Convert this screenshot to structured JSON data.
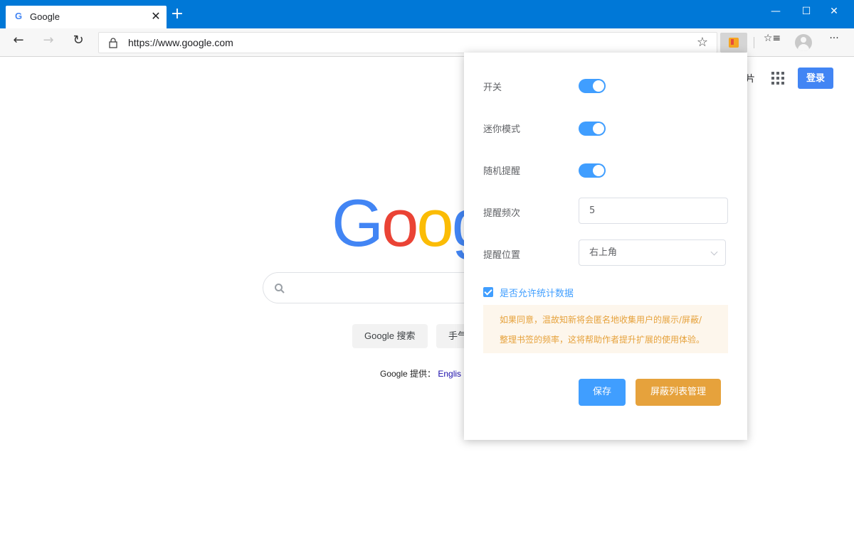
{
  "browser": {
    "tab": {
      "favicon": "G",
      "title": "Google",
      "close": "✕"
    },
    "new_tab": "+",
    "window": {
      "minimize": "—",
      "maximize": "☐",
      "close": "✕"
    },
    "toolbar": {
      "back": "←",
      "forward": "→",
      "refresh": "↻",
      "url": "https://www.google.com",
      "favorite": "☆",
      "favorites_list": "☆≡",
      "more": "···"
    }
  },
  "google": {
    "images_partial": "片",
    "signin": "登录",
    "logo_visible": "Goog",
    "btn_search": "Google 搜索",
    "btn_lucky_partial": "手气",
    "offered_in": "Google 提供：",
    "lang_link_partial": "Englis"
  },
  "popup": {
    "switch_label": "开关",
    "mini_label": "迷你模式",
    "random_label": "随机提醒",
    "frequency_label": "提醒频次",
    "frequency_value": "5",
    "position_label": "提醒位置",
    "position_value": "右上角",
    "allow_stats_label": "是否允许统计数据",
    "notice_line1": "如果同意，温故知新将会匿名地收集用户的展示/屏蔽/",
    "notice_line2": "整理书签的频率，这将帮助作者提升扩展的使用体验。",
    "save_button": "保存",
    "manage_button": "屏蔽列表管理",
    "toggles": {
      "switch": true,
      "mini": true,
      "random": true,
      "allow_stats": true
    }
  },
  "colors": {
    "titlebar": "#0078d7",
    "primary": "#409eff",
    "warning": "#e6a23c",
    "notice_bg": "#fdf6ec"
  }
}
